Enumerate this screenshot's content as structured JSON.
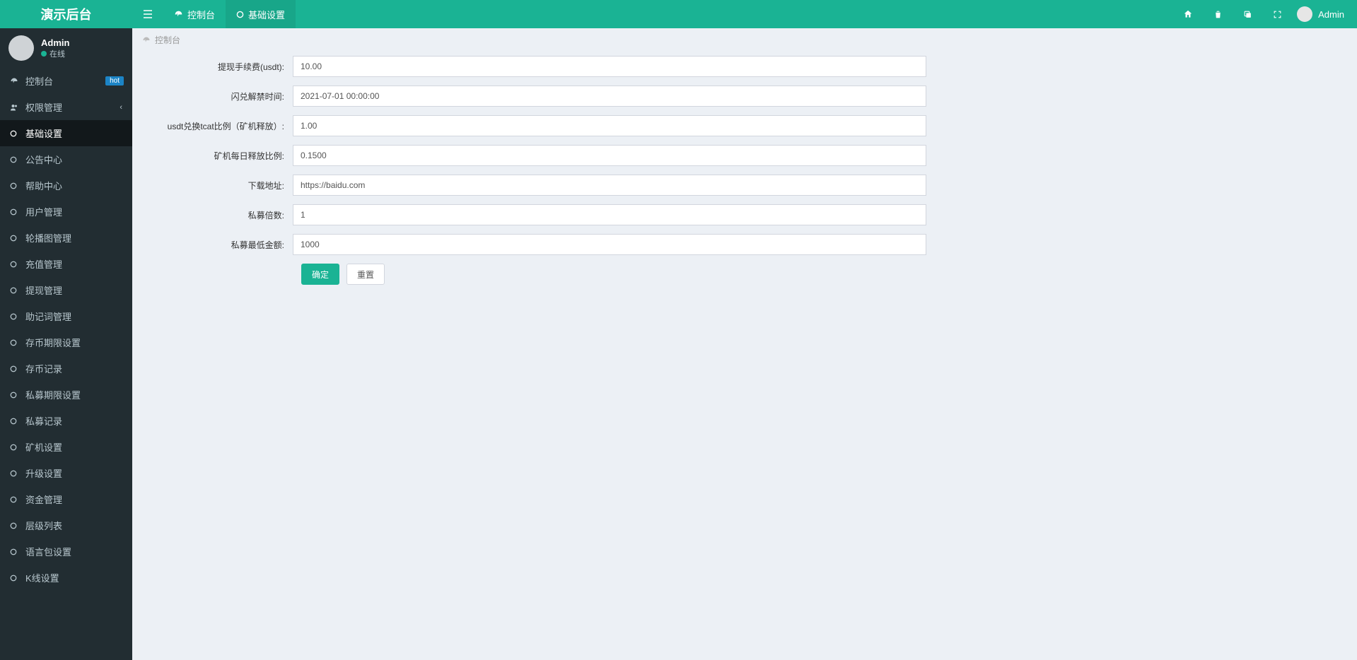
{
  "app": {
    "title": "演示后台"
  },
  "topbar": {
    "tabs": [
      {
        "label": "控制台"
      },
      {
        "label": "基础设置"
      }
    ],
    "user_name": "Admin"
  },
  "sidebar": {
    "user": {
      "name": "Admin",
      "status": "在线"
    },
    "items": [
      {
        "label": "控制台",
        "badge": "hot",
        "icon": "dashboard"
      },
      {
        "label": "权限管理",
        "expandable": true,
        "icon": "users"
      },
      {
        "label": "基础设置",
        "active": true,
        "icon": "circle"
      },
      {
        "label": "公告中心",
        "icon": "circle"
      },
      {
        "label": "帮助中心",
        "icon": "circle"
      },
      {
        "label": "用户管理",
        "icon": "circle"
      },
      {
        "label": "轮播图管理",
        "icon": "circle"
      },
      {
        "label": "充值管理",
        "icon": "circle"
      },
      {
        "label": "提现管理",
        "icon": "circle"
      },
      {
        "label": "助记词管理",
        "icon": "circle"
      },
      {
        "label": "存币期限设置",
        "icon": "circle"
      },
      {
        "label": "存币记录",
        "icon": "circle"
      },
      {
        "label": "私募期限设置",
        "icon": "circle"
      },
      {
        "label": "私募记录",
        "icon": "circle"
      },
      {
        "label": "矿机设置",
        "icon": "circle"
      },
      {
        "label": "升级设置",
        "icon": "circle"
      },
      {
        "label": "资金管理",
        "icon": "circle"
      },
      {
        "label": "层级列表",
        "icon": "circle"
      },
      {
        "label": "语言包设置",
        "icon": "circle"
      },
      {
        "label": "K线设置",
        "icon": "circle"
      }
    ]
  },
  "breadcrumb": {
    "text": "控制台"
  },
  "form": {
    "fields": [
      {
        "label": "提现手续费(usdt):",
        "value": "10.00"
      },
      {
        "label": "闪兑解禁时间:",
        "value": "2021-07-01 00:00:00"
      },
      {
        "label": "usdt兑换tcat比例（矿机释放）:",
        "value": "1.00"
      },
      {
        "label": "矿机每日释放比例:",
        "value": "0.1500"
      },
      {
        "label": "下载地址:",
        "value": "https://baidu.com"
      },
      {
        "label": "私募倍数:",
        "value": "1"
      },
      {
        "label": "私募最低金额:",
        "value": "1000"
      }
    ],
    "submit_label": "确定",
    "reset_label": "重置"
  }
}
